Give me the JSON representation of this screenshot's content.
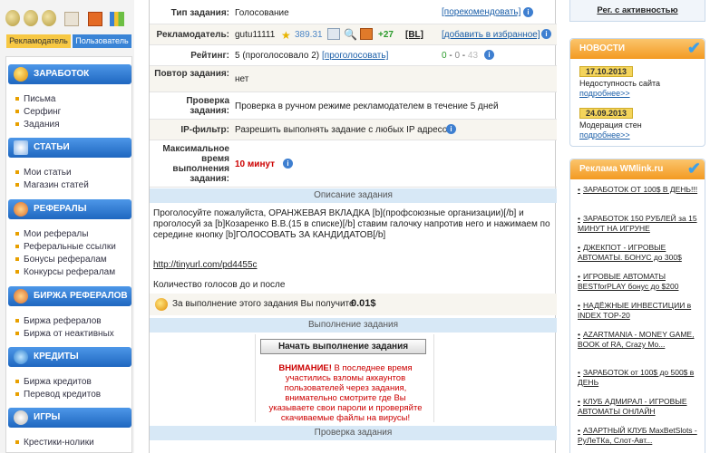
{
  "sidebar": {
    "tabs": [
      "Рекламодатель",
      "Пользователь"
    ],
    "sections": [
      {
        "title": "ЗАРАБОТОК",
        "items": [
          "Письма",
          "Серфинг",
          "Задания"
        ]
      },
      {
        "title": "СТАТЬИ",
        "items": [
          "Мои статьи",
          "Магазин статей"
        ]
      },
      {
        "title": "РЕФЕРАЛЫ",
        "items": [
          "Мои рефералы",
          "Реферальные ссылки",
          "Бонусы рефералам",
          "Конкурсы рефералам"
        ]
      },
      {
        "title": "БИРЖА РЕФЕРАЛОВ",
        "items": [
          "Биржа рефералов",
          "Биржа от неактивных"
        ]
      },
      {
        "title": "КРЕДИТЫ",
        "items": [
          "Биржа кредитов",
          "Перевод кредитов"
        ]
      },
      {
        "title": "ИГРЫ",
        "items": [
          "Крестики-нолики"
        ]
      }
    ]
  },
  "task": {
    "type_label": "Тип задания:",
    "type_value": "Голосование",
    "recommend_link": "[порекомендовать]",
    "advertiser_label": "Рекламодатель:",
    "advertiser_name": "gutu11111",
    "advertiser_score": "389.31",
    "advertiser_plus": "+27",
    "bl_link": "[BL]",
    "favorite_link": "[добавить в избранное]",
    "rating_label": "Рейтинг:",
    "rating_value": "5 (проголосовало 2)",
    "vote_link": "[проголосовать]",
    "rating_counts": [
      "0",
      "0",
      "43"
    ],
    "repeat_label": "Повтор задания:",
    "repeat_value": "нет",
    "check_label": "Проверка задания:",
    "check_value": "Проверка в ручном режиме рекламодателем в течение 5 дней",
    "ip_label": "IP-фильтр:",
    "ip_value": "Разрешить выполнять задание с любых IP адресов",
    "time_label": "Максимальное время выполнения задания:",
    "time_value": "10 минут",
    "description_header": "Описание задания",
    "description_text": "Проголосуйте пожалуйста, ОРАНЖЕВАЯ ВКЛАДКА [b](профсоюзные организации)[/b] и проголосуй за [b]Козаренко В.В.(15 в списке)[/b] ставим галочку напротив него и нажимаем по середине кнопку [b]ГОЛОСОВАТЬ ЗА КАНДИДАТОВ[/b]",
    "description_link": "http://tinyurl.com/pd4455c",
    "description_note": "Количество голосов до и после",
    "reward_text": "За выполнение этого задания Вы получите",
    "reward_value": "0.01$",
    "execution_header": "Выполнение задания",
    "start_button": "Начать выполнение задания",
    "warning_title": "ВНИМАНИЕ!",
    "warning_text": "В последнее время участились взломы аккаунтов пользователей через задания, внимательно смотрите где Вы указываете свои пароли и проверяйте скачиваемые файлы на вирусы!",
    "check_header": "Проверка задания"
  },
  "right": {
    "top_link": "Рег. с активностью",
    "news_title": "НОВОСТИ",
    "news": [
      {
        "date": "17.10.2013",
        "text": "Недоступность сайта",
        "more": "подробнее>>"
      },
      {
        "date": "24.09.2013",
        "text": "Модерация стен",
        "more": "подробнее>>"
      }
    ],
    "ads_title": "Реклама WMlink.ru",
    "ads": [
      "ЗАРАБОТОК ОТ 100$ В ДЕНЬ!!!",
      "ЗАРАБОТОК 150 РУБЛЕЙ за 15 МИНУТ НА ИГРУНЕ",
      "ДЖЕКПОТ - ИГРОВЫЕ АВТОМАТЫ. БОНУС до 300$",
      "ИГРОВЫЕ АВТОМАТЫ BESTforPLAY бонус до $200",
      "НАДЁЖНЫЕ ИНВЕСТИЦИИ в INDEX TOP-20",
      "AZARTMANIA - MONEY GAME, BOOK of RA, Crazy Mo...",
      "ЗАРАБОТОК от 100$ до 500$ в ДЕНЬ",
      "КЛУБ АДМИРАЛ - ИГРОВЫЕ АВТОМАТЫ ОНЛАЙН",
      "АЗАРТНЫЙ КЛУБ MaxBetSlots - РуЛеТКа, Слот-Авт..."
    ]
  }
}
